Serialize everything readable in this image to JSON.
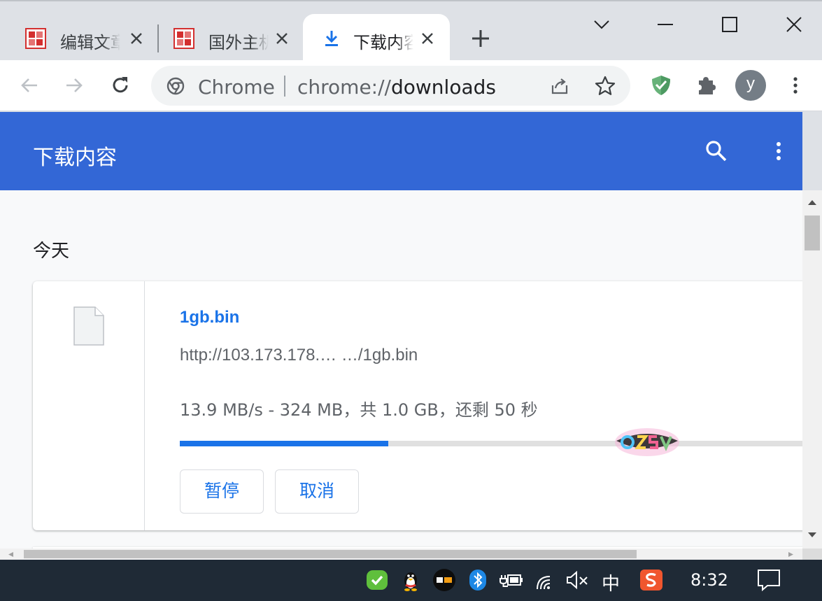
{
  "tabs": [
    {
      "title": "编辑文章",
      "favicon": "seal-icon"
    },
    {
      "title": "国外主机",
      "favicon": "seal-icon"
    },
    {
      "title": "下载内容",
      "favicon": "download-icon",
      "active": true
    }
  ],
  "omnibox": {
    "site_label": "Chrome",
    "url_scheme": "chrome://",
    "url_host": "downloads"
  },
  "profile": {
    "initial": "y"
  },
  "page": {
    "title": "下载内容",
    "date_header": "今天",
    "download": {
      "file_name": "1gb.bin",
      "url": "http://103.173.178.… …/1gb.bin",
      "status": "13.9 MB/s - 324 MB，共 1.0 GB，还剩 50 秒",
      "progress": 0.324,
      "pause_label": "暂停",
      "cancel_label": "取消"
    }
  },
  "taskbar": {
    "ime": "中",
    "time": "8:32"
  },
  "colors": {
    "accent": "#1a73e8",
    "appbar": "#3367d6",
    "taskbar": "#1f2a36"
  }
}
